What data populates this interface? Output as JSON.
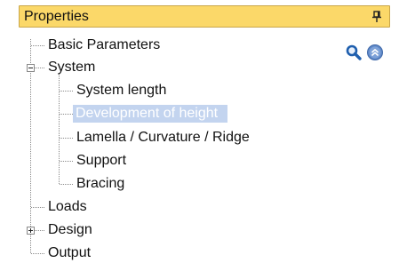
{
  "panel": {
    "title": "Properties",
    "pin_icon": "pin-icon"
  },
  "tools": {
    "search_icon": "search-icon",
    "collapse_icon": "collapse-all-icon"
  },
  "tree": {
    "basic_parameters": "Basic Parameters",
    "system": {
      "label": "System",
      "expanded": true,
      "children": {
        "system_length": "System length",
        "development_of_height": "Development of height",
        "lamella": "Lamella / Curvature / Ridge",
        "support": "Support",
        "bracing": "Bracing"
      }
    },
    "loads": "Loads",
    "design": {
      "label": "Design",
      "expanded": false
    },
    "output": "Output",
    "selected": "Development of height"
  },
  "colors": {
    "header_bg": "#fbd869",
    "header_border": "#c9a64a",
    "selection_bg": "#c3d4ef",
    "icon_blue": "#1f5fae"
  }
}
